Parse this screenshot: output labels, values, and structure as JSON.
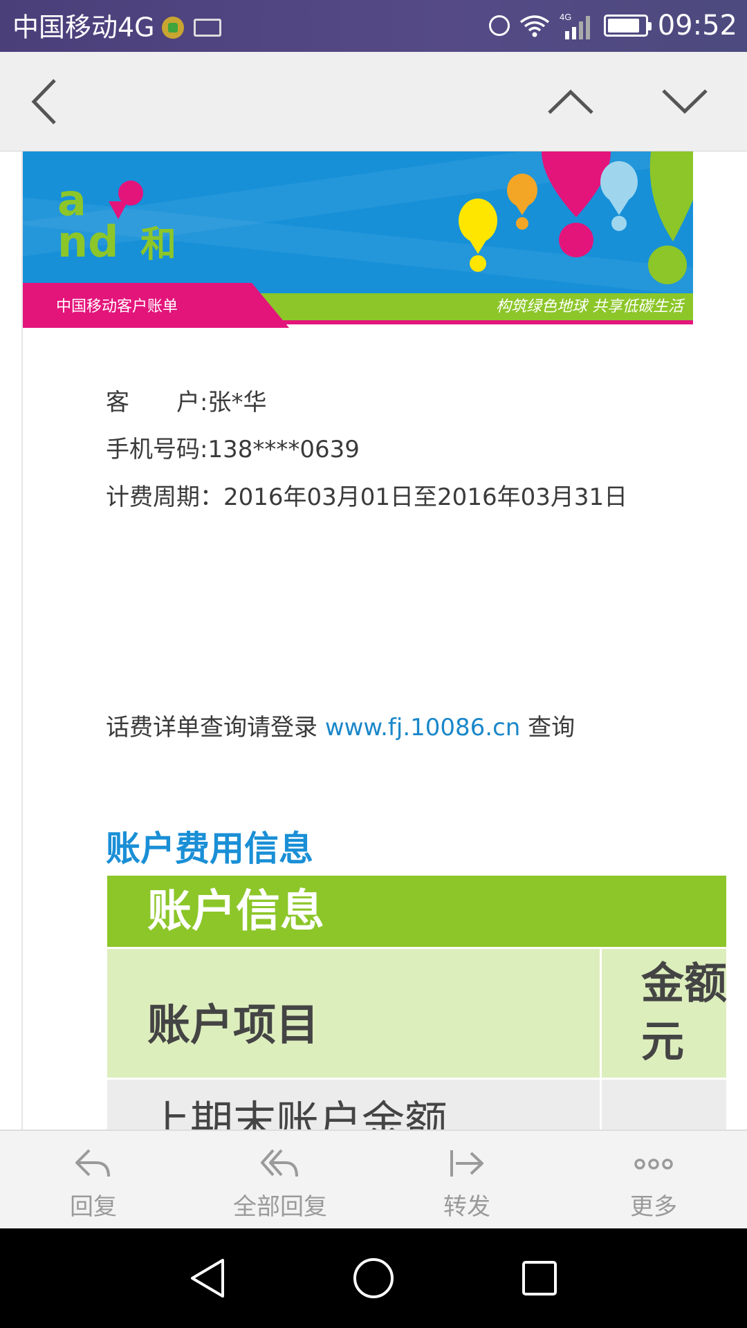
{
  "status_bar": {
    "carrier": "中国移动4G",
    "network_label": "4G",
    "time": "09:52",
    "icons": [
      "carrier-badge-icon",
      "keyboard-icon",
      "alarm-icon",
      "wifi-icon",
      "signal-icon",
      "battery-icon"
    ]
  },
  "app_bar": {
    "icons": [
      "back-arrow-icon",
      "previous-up-icon",
      "next-down-icon"
    ]
  },
  "banner": {
    "left_label": "中国移动客户账单",
    "right_label": "构筑绿色地球  共享低碳生活",
    "brand_colors": {
      "blue": "#1790d8",
      "green": "#8cc629",
      "pink": "#e3157b"
    }
  },
  "bill_info": {
    "customer_label": "客　　户:",
    "customer_name": "张*华",
    "phone_label": "手机号码:",
    "phone_value": "138****0639",
    "period_label": "计费周期：",
    "period_value": "2016年03月01日至2016年03月31日"
  },
  "query": {
    "prefix": "话费详单查询请登录 ",
    "link": "www.fj.10086.cn",
    "suffix": " 查询"
  },
  "section_title": "账户费用信息",
  "account_table": {
    "header": "账户信息",
    "columns": [
      "账户项目",
      "金额/元"
    ],
    "rows": [
      {
        "item": "上期末账户余额"
      }
    ]
  },
  "actions": {
    "reply": "回复",
    "reply_all": "全部回复",
    "forward": "转发",
    "more": "更多"
  }
}
